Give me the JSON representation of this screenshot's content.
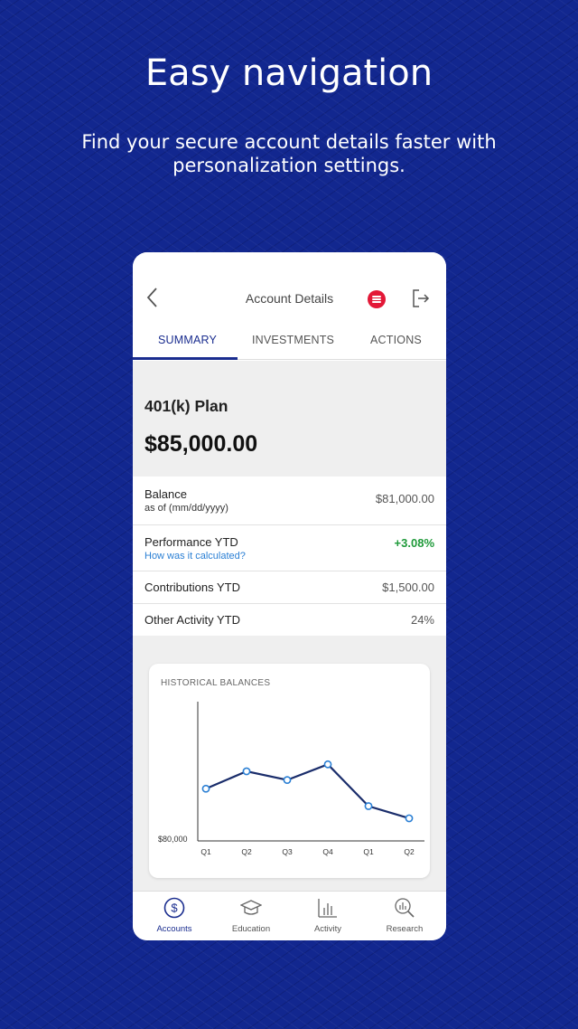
{
  "hero": {
    "title": "Easy navigation",
    "subtitle": "Find your secure account details faster with personalization settings."
  },
  "app": {
    "header_title": "Account Details",
    "icons": {
      "back": "chevron-left-icon",
      "brand": "brand-logo-icon",
      "logout": "logout-icon"
    },
    "tabs": [
      {
        "label": "SUMMARY",
        "active": true
      },
      {
        "label": "INVESTMENTS",
        "active": false
      },
      {
        "label": "ACTIONS",
        "active": false
      }
    ],
    "plan": {
      "name": "401(k) Plan",
      "total": "$85,000.00"
    },
    "rows": {
      "balance": {
        "label": "Balance",
        "sub": "as of (mm/dd/yyyy)",
        "value": "$81,000.00"
      },
      "performance": {
        "label": "Performance YTD",
        "link": "How was it calculated?",
        "value": "+3.08%"
      },
      "contributions": {
        "label": "Contributions YTD",
        "value": "$1,500.00"
      },
      "other": {
        "label": "Other Activity YTD",
        "value": "24%"
      }
    },
    "bottom_nav": [
      {
        "label": "Accounts",
        "icon": "dollar-circle-icon",
        "active": true
      },
      {
        "label": "Education",
        "icon": "graduation-cap-icon",
        "active": false
      },
      {
        "label": "Activity",
        "icon": "bar-chart-icon",
        "active": false
      },
      {
        "label": "Research",
        "icon": "magnifier-chart-icon",
        "active": false
      }
    ]
  },
  "colors": {
    "background": "#12278f",
    "accent": "#1a2d8f",
    "positive": "#1f9a3a",
    "link": "#2a7fd4",
    "brand_red": "#e31837"
  },
  "chart_data": {
    "type": "line",
    "title": "HISTORICAL BALANCES",
    "categories": [
      "Q1",
      "Q2",
      "Q3",
      "Q4",
      "Q1",
      "Q2"
    ],
    "y_tick_label": "$80,000",
    "ylim": [
      80000,
      88000
    ],
    "series": [
      {
        "values": [
          83000,
          84000,
          83500,
          84400,
          82000,
          81300
        ]
      }
    ],
    "grid": false,
    "xlabel": "",
    "ylabel": ""
  }
}
